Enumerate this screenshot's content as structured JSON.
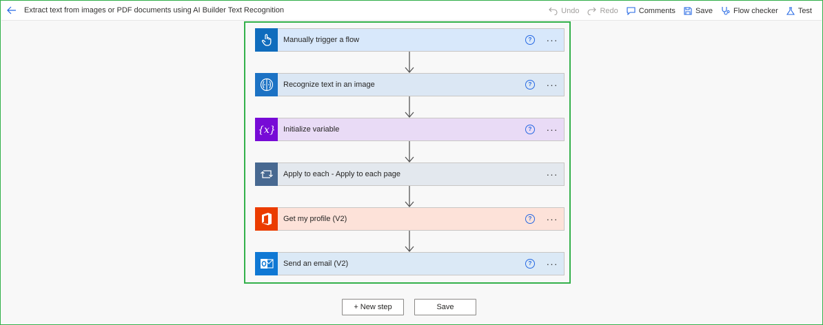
{
  "header": {
    "title": "Extract text from images or PDF documents using AI Builder Text Recognition",
    "commands": [
      {
        "label": "Undo",
        "icon": "undo-icon",
        "enabled": false
      },
      {
        "label": "Redo",
        "icon": "redo-icon",
        "enabled": false
      },
      {
        "label": "Comments",
        "icon": "comment-icon",
        "enabled": true
      },
      {
        "label": "Save",
        "icon": "save-icon",
        "enabled": true
      },
      {
        "label": "Flow checker",
        "icon": "stethoscope-icon",
        "enabled": true
      },
      {
        "label": "Test",
        "icon": "flask-icon",
        "enabled": true
      }
    ]
  },
  "steps": [
    {
      "label": "Manually trigger a flow",
      "icon": "touch-icon",
      "icon_bg": "#0f6cbd",
      "bar_bg": "#d8e8fb",
      "has_help": true
    },
    {
      "label": "Recognize text in an image",
      "icon": "ai-brain-icon",
      "icon_bg": "#1c72c4",
      "bar_bg": "#dbe7f4",
      "has_help": true
    },
    {
      "label": "Initialize variable",
      "icon": "variable-icon",
      "icon_bg": "#770bd6",
      "bar_bg": "#e9dbf6",
      "has_help": true
    },
    {
      "label": "Apply to each - Apply to each page",
      "icon": "loop-icon",
      "icon_bg": "#486991",
      "bar_bg": "#e3e8ee",
      "has_help": false
    },
    {
      "label": "Get my profile (V2)",
      "icon": "office-icon",
      "icon_bg": "#eb3c00",
      "bar_bg": "#fde2d9",
      "has_help": true
    },
    {
      "label": "Send an email (V2)",
      "icon": "outlook-icon",
      "icon_bg": "#0f78d4",
      "bar_bg": "#dbe9f6",
      "has_help": true
    }
  ],
  "footer": {
    "new_step_label": "+ New step",
    "save_label": "Save"
  },
  "colors": {
    "accent": "#31b049",
    "link": "#2266e3"
  }
}
